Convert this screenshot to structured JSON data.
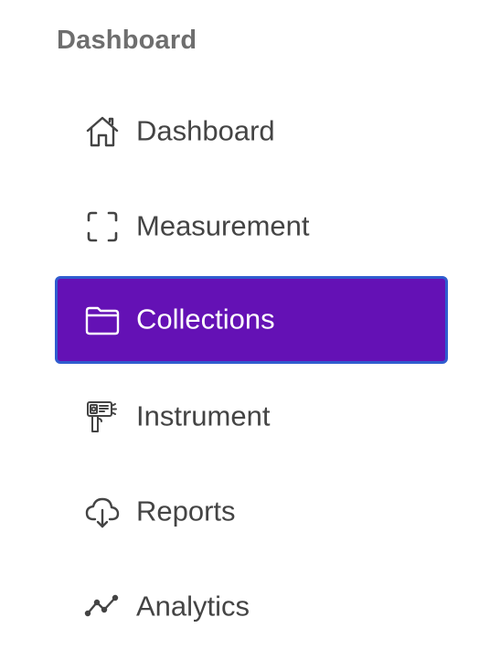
{
  "sidebar": {
    "section_title": "Dashboard",
    "active_item": "Collections",
    "colors": {
      "active_background": "#6411b5",
      "active_border": "#2f5ccf",
      "text": "#444444",
      "title": "#6e6e6e"
    },
    "items": [
      {
        "label": "Dashboard",
        "icon": "home-icon"
      },
      {
        "label": "Measurement",
        "icon": "scan-frame-icon"
      },
      {
        "label": "Collections",
        "icon": "folder-icon"
      },
      {
        "label": "Instrument",
        "icon": "thermal-gun-icon"
      },
      {
        "label": "Reports",
        "icon": "cloud-download-icon"
      },
      {
        "label": "Analytics",
        "icon": "trend-line-icon"
      }
    ]
  }
}
